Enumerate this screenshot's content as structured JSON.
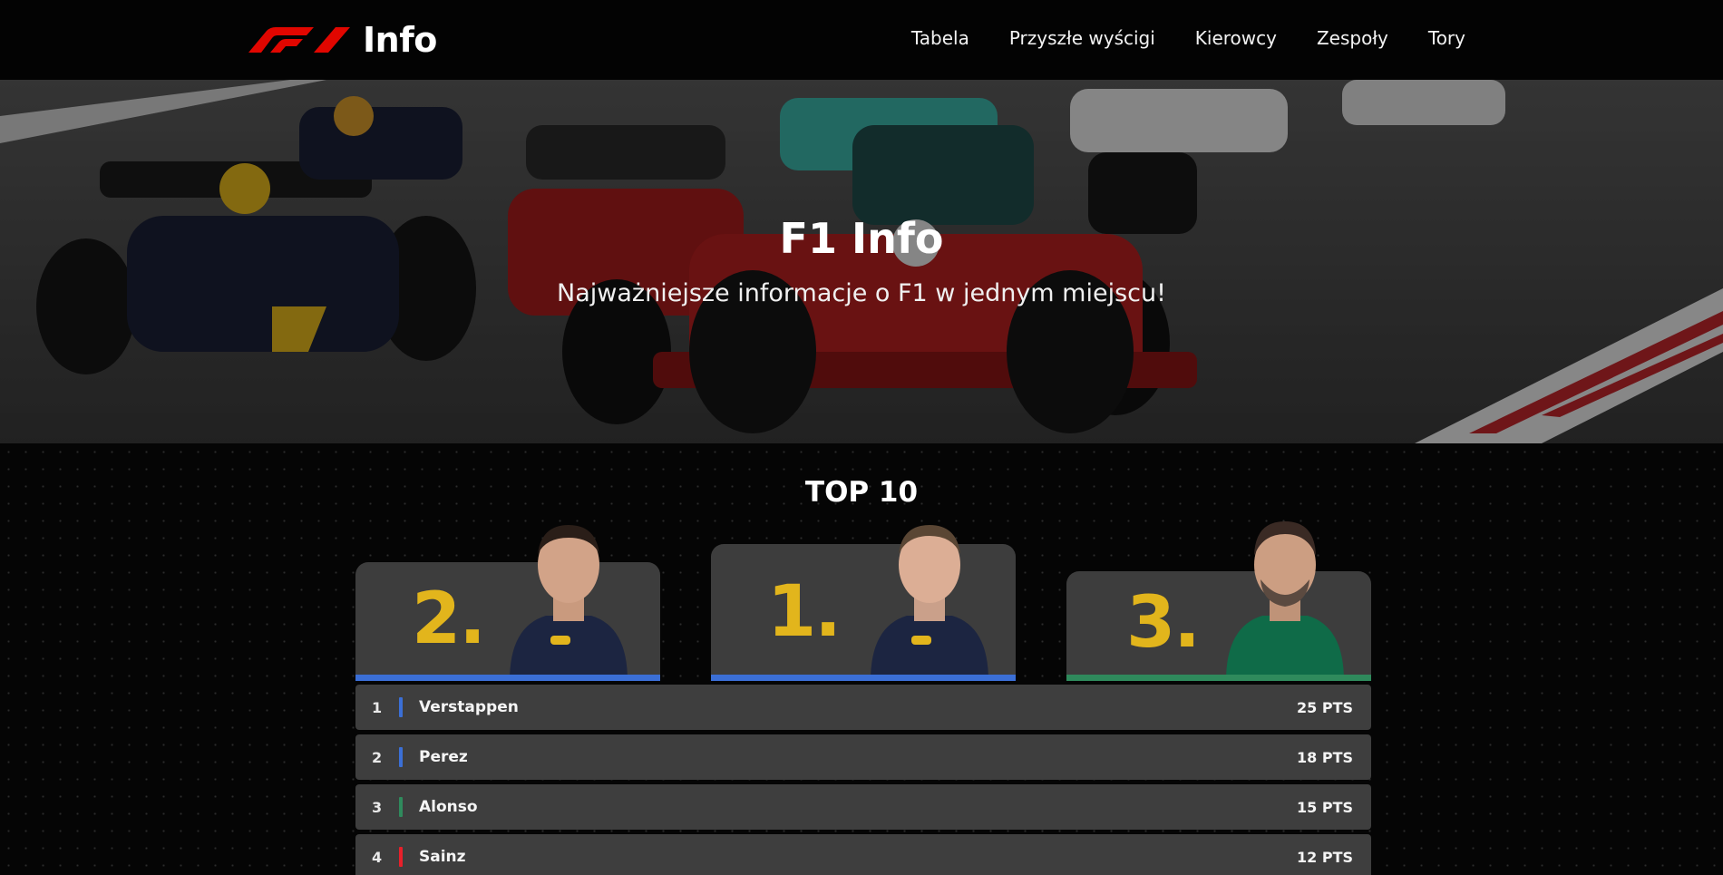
{
  "navbar": {
    "logo_text": "Info",
    "links": [
      "Tabela",
      "Przyszłe wyścigi",
      "Kierowcy",
      "Zespoły",
      "Tory"
    ]
  },
  "hero": {
    "title": "F1 Info",
    "subtitle": "Najważniejsze informacje o F1 w jednym miejscu!"
  },
  "top10": {
    "title": "TOP 10",
    "podium": [
      {
        "place": "2.",
        "team_color": "#3b6fd6",
        "suit_color": "#1c2541"
      },
      {
        "place": "1.",
        "team_color": "#3b6fd6",
        "suit_color": "#1c2541"
      },
      {
        "place": "3.",
        "team_color": "#2f8a5c",
        "suit_color": "#0f6b48"
      }
    ],
    "rows": [
      {
        "pos": "1",
        "name": "Verstappen",
        "pts": "25 PTS",
        "color": "#3b6fd6"
      },
      {
        "pos": "2",
        "name": "Perez",
        "pts": "18 PTS",
        "color": "#3b6fd6"
      },
      {
        "pos": "3",
        "name": "Alonso",
        "pts": "15 PTS",
        "color": "#2f8a5c"
      },
      {
        "pos": "4",
        "name": "Sainz",
        "pts": "12 PTS",
        "color": "#e8202a"
      }
    ]
  },
  "colors": {
    "brand_red": "#e10600",
    "gold": "#e2b51c"
  }
}
